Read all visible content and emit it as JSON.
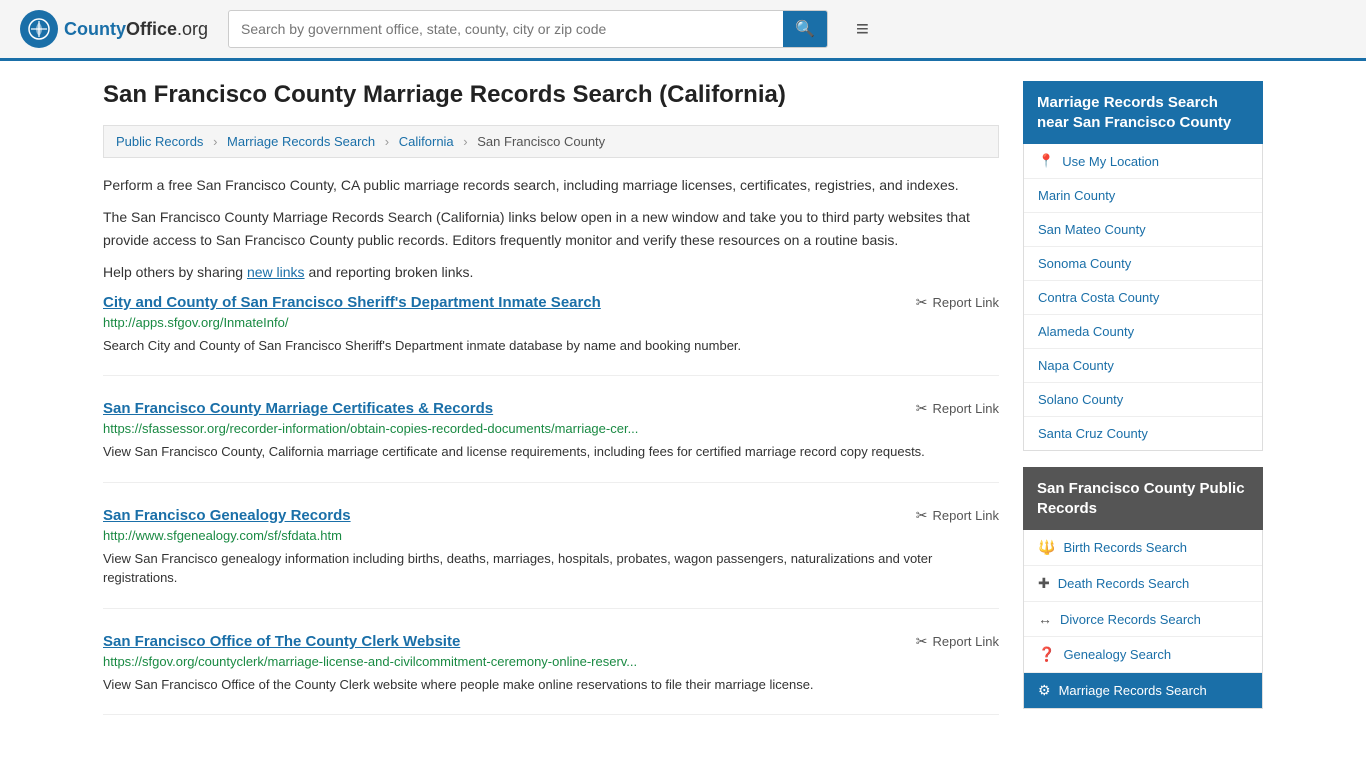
{
  "header": {
    "logo_text": "CountyOffice",
    "logo_domain": ".org",
    "search_placeholder": "Search by government office, state, county, city or zip code"
  },
  "page": {
    "title": "San Francisco County Marriage Records Search (California)",
    "breadcrumbs": [
      {
        "label": "Public Records",
        "href": "#"
      },
      {
        "label": "Marriage Records Search",
        "href": "#"
      },
      {
        "label": "California",
        "href": "#"
      },
      {
        "label": "San Francisco County",
        "href": "#"
      }
    ],
    "description1": "Perform a free San Francisco County, CA public marriage records search, including marriage licenses, certificates, registries, and indexes.",
    "description2": "The San Francisco County Marriage Records Search (California) links below open in a new window and take you to third party websites that provide access to San Francisco County public records. Editors frequently monitor and verify these resources on a routine basis.",
    "description3_pre": "Help others by sharing ",
    "description3_link": "new links",
    "description3_post": " and reporting broken links."
  },
  "results": [
    {
      "title": "City and County of San Francisco Sheriff's Department Inmate Search",
      "url": "http://apps.sfgov.org/InmateInfo/",
      "desc": "Search City and County of San Francisco Sheriff's Department inmate database by name and booking number.",
      "report": "Report Link"
    },
    {
      "title": "San Francisco County Marriage Certificates & Records",
      "url": "https://sfassessor.org/recorder-information/obtain-copies-recorded-documents/marriage-cer...",
      "desc": "View San Francisco County, California marriage certificate and license requirements, including fees for certified marriage record copy requests.",
      "report": "Report Link"
    },
    {
      "title": "San Francisco Genealogy Records",
      "url": "http://www.sfgenealogy.com/sf/sfdata.htm",
      "desc": "View San Francisco genealogy information including births, deaths, marriages, hospitals, probates, wagon passengers, naturalizations and voter registrations.",
      "report": "Report Link"
    },
    {
      "title": "San Francisco Office of The County Clerk Website",
      "url": "https://sfgov.org/countyclerk/marriage-license-and-civilcommitment-ceremony-online-reserv...",
      "desc": "View San Francisco Office of the County Clerk website where people make online reservations to file their marriage license.",
      "report": "Report Link"
    }
  ],
  "sidebar": {
    "nearby_header": "Marriage Records Search near San Francisco County",
    "use_my_location": "Use My Location",
    "nearby_counties": [
      {
        "name": "Marin County"
      },
      {
        "name": "San Mateo County"
      },
      {
        "name": "Sonoma County"
      },
      {
        "name": "Contra Costa County"
      },
      {
        "name": "Alameda County"
      },
      {
        "name": "Napa County"
      },
      {
        "name": "Solano County"
      },
      {
        "name": "Santa Cruz County"
      }
    ],
    "public_records_header": "San Francisco County Public Records",
    "public_records_items": [
      {
        "icon": "🔱",
        "label": "Birth Records Search",
        "active": false
      },
      {
        "icon": "+",
        "label": "Death Records Search",
        "active": false
      },
      {
        "icon": "↔",
        "label": "Divorce Records Search",
        "active": false
      },
      {
        "icon": "?",
        "label": "Genealogy Search",
        "active": false
      },
      {
        "icon": "⚙",
        "label": "Marriage Records Search",
        "active": true
      }
    ]
  }
}
